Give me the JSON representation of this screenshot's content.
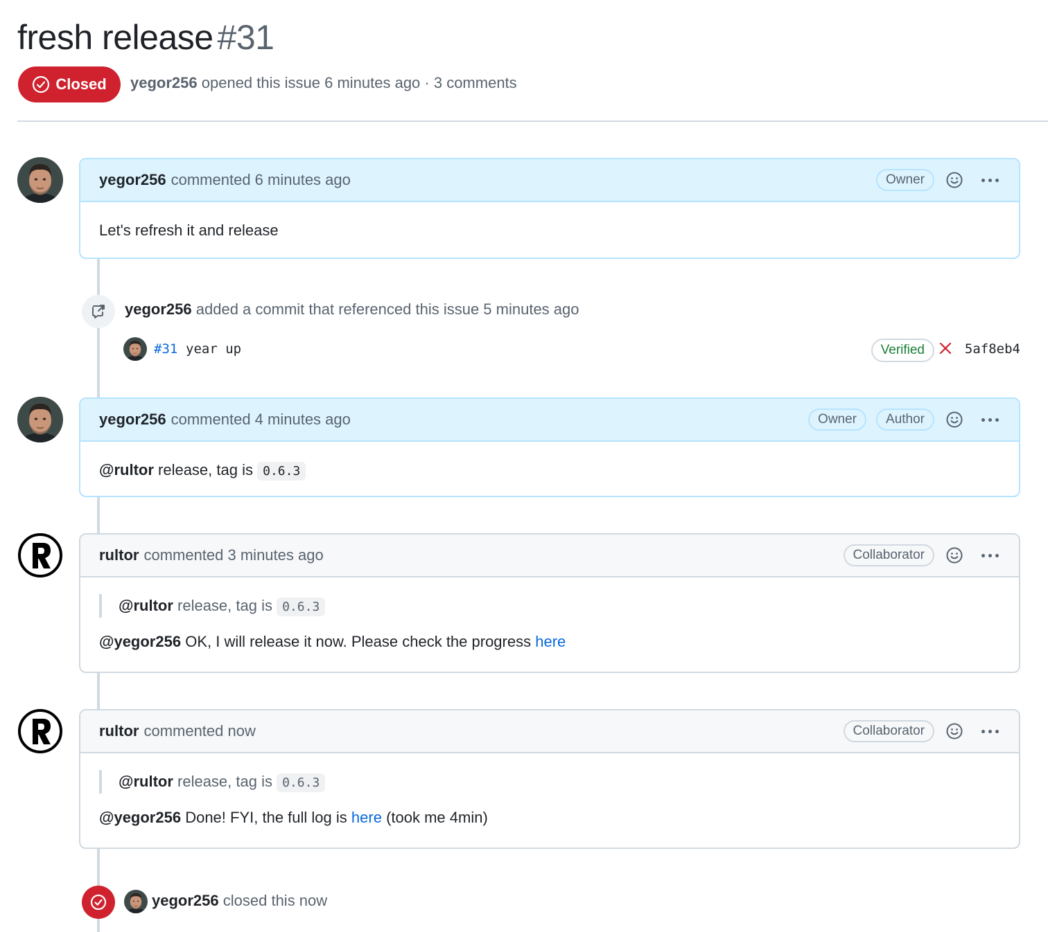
{
  "header": {
    "title": "fresh release",
    "number": "#31",
    "state": "Closed",
    "author": "yegor256",
    "opened_text": "opened this issue 6 minutes ago · 3 comments"
  },
  "colors": {
    "closed_red": "#cf222e",
    "owner_blue_bg": "#ddf4ff",
    "owner_blue_border": "#b6e3ff",
    "link_blue": "#0969da",
    "verified_green": "#1a7f37"
  },
  "comments": [
    {
      "author": "yegor256",
      "action": "commented 6 minutes ago",
      "roles": [
        "Owner"
      ],
      "body": "Let's refresh it and release"
    },
    {
      "author": "yegor256",
      "action": "commented 4 minutes ago",
      "roles": [
        "Owner",
        "Author"
      ],
      "mention": "@rultor",
      "text": "release, tag is",
      "code": "0.6.3"
    },
    {
      "author": "rultor",
      "action": "commented 3 minutes ago",
      "roles": [
        "Collaborator"
      ],
      "quote_mention": "@rultor",
      "quote_text": "release, tag is",
      "quote_code": "0.6.3",
      "mention": "@yegor256",
      "text": "OK, I will release it now. Please check the progress",
      "link": "here"
    },
    {
      "author": "rultor",
      "action": "commented now",
      "roles": [
        "Collaborator"
      ],
      "quote_mention": "@rultor",
      "quote_text": "release, tag is",
      "quote_code": "0.6.3",
      "mention": "@yegor256",
      "text": "Done! FYI, the full log is",
      "link": "here",
      "suffix": "(took me 4min)"
    }
  ],
  "events": {
    "commit_ref": {
      "author": "yegor256",
      "text": "added a commit that referenced this issue 5 minutes ago",
      "commit_ref_label": "#31",
      "commit_message": "year up",
      "verified": "Verified",
      "sha": "5af8eb4"
    },
    "closed": {
      "author": "yegor256",
      "text": "closed this now"
    }
  },
  "icons": {
    "state": "issue-closed-icon",
    "reaction": "smiley-icon",
    "menu": "kebab-horizontal-icon",
    "cross_ref": "cross-reference-icon",
    "status": "x-icon"
  }
}
